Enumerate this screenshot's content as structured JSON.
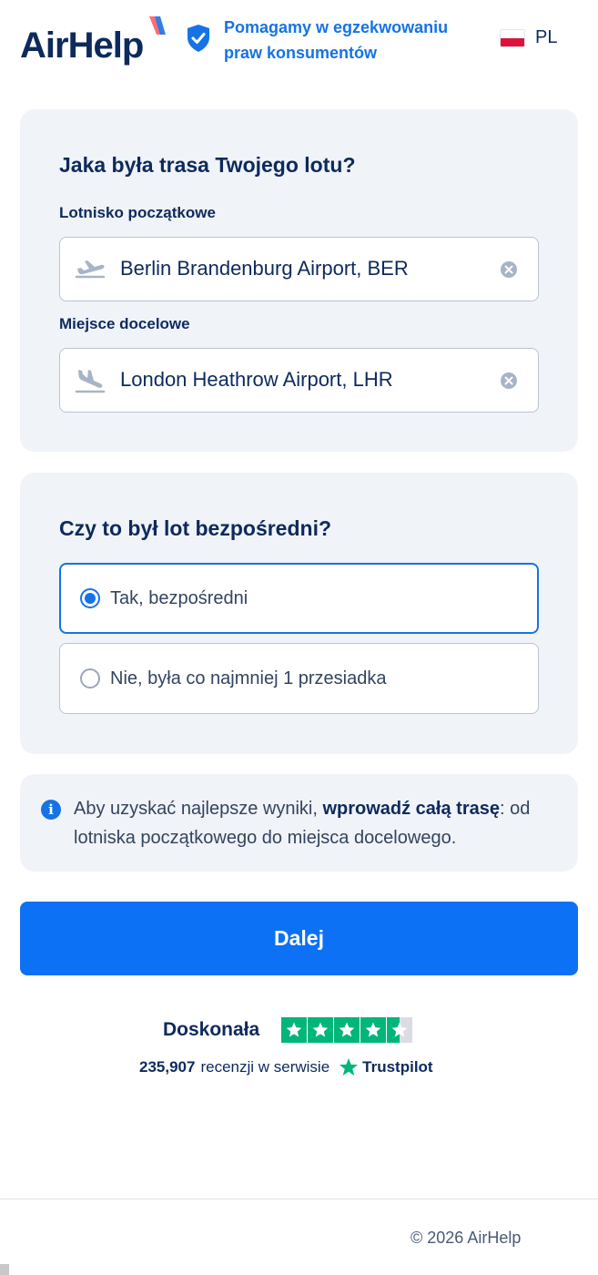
{
  "header": {
    "logo_text": "AirHelp",
    "tagline": "Pomagamy w egzekwowaniu praw konsumentów",
    "language": "PL"
  },
  "route": {
    "title": "Jaka była trasa Twojego lotu?",
    "departure_label": "Lotnisko początkowe",
    "departure_value": "Berlin Brandenburg Airport, BER",
    "arrival_label": "Miejsce docelowe",
    "arrival_value": "London Heathrow Airport, LHR"
  },
  "direct": {
    "title": "Czy to był lot bezpośredni?",
    "options": [
      {
        "label": "Tak, bezpośredni",
        "selected": true
      },
      {
        "label": "Nie, była co najmniej 1 przesiadka",
        "selected": false
      }
    ]
  },
  "info": {
    "text_before": "Aby uzyskać najlepsze wyniki, ",
    "text_bold": "wprowadź całą trasę",
    "text_after": ": od lotniska początkowego do miejsca docelowego."
  },
  "continue_label": "Dalej",
  "trustpilot": {
    "rating_word": "Doskonała",
    "stars": 4.5,
    "review_count": "235,907",
    "reviews_text": "recenzji w serwisie",
    "brand": "Trustpilot"
  },
  "footer": {
    "copyright": "© 2026 AirHelp"
  },
  "colors": {
    "primary": "#0c71f5",
    "navy": "#0d2a5c",
    "card_bg": "#f0f3f8",
    "trustpilot_green": "#00b67a"
  }
}
